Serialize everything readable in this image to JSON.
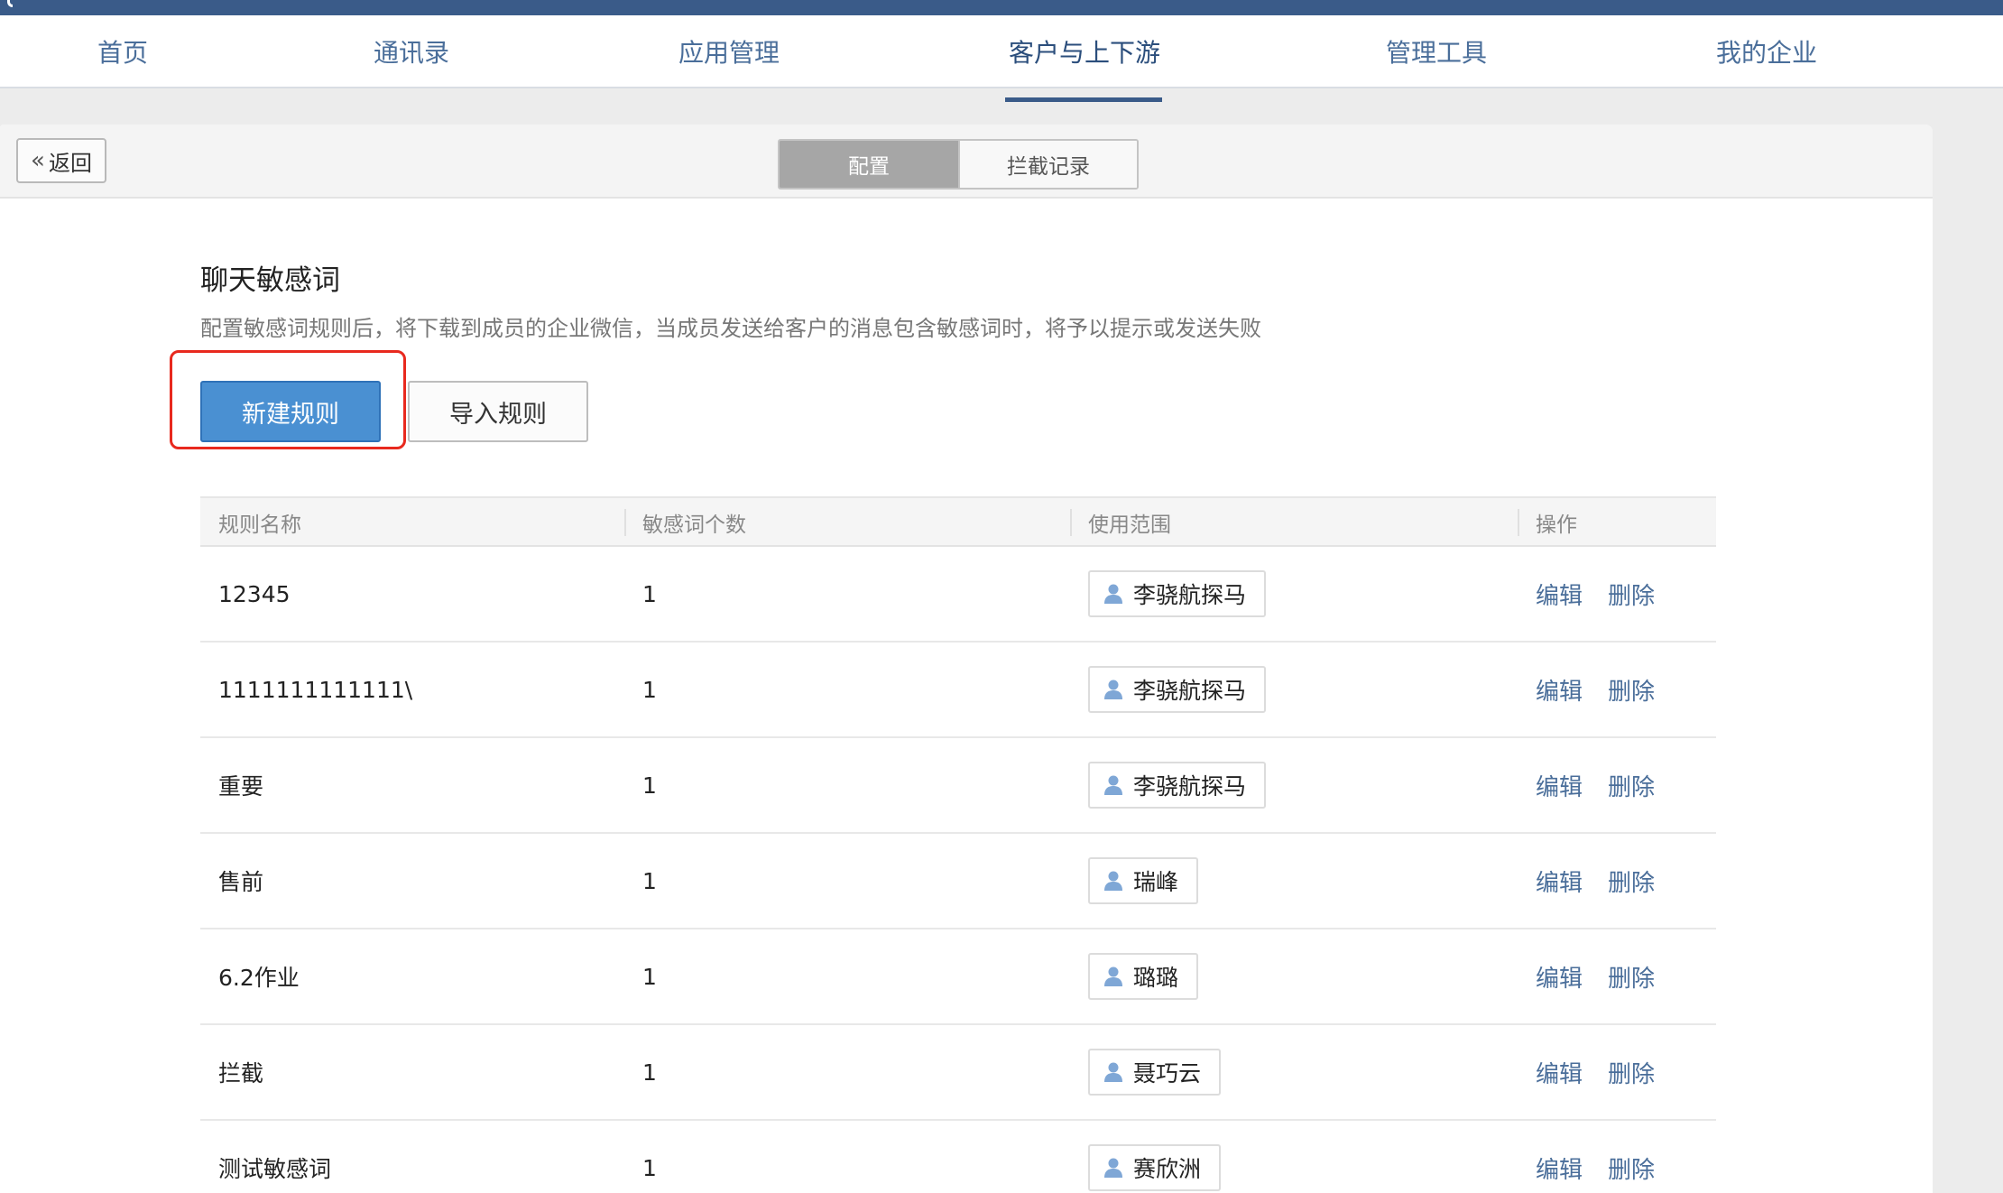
{
  "nav": {
    "items": [
      {
        "label": "首页"
      },
      {
        "label": "通讯录"
      },
      {
        "label": "应用管理"
      },
      {
        "label": "客户与上下游"
      },
      {
        "label": "管理工具"
      },
      {
        "label": "我的企业"
      }
    ],
    "active_index": 3
  },
  "toolbar": {
    "back_label": "返回",
    "back_icon": "double-chevron-left-icon",
    "tabs": [
      {
        "label": "配置",
        "active": true
      },
      {
        "label": "拦截记录",
        "active": false
      }
    ]
  },
  "section": {
    "title": "聊天敏感词",
    "description": "配置敏感词规则后，将下载到成员的企业微信，当成员发送给客户的消息包含敏感词时，将予以提示或发送失败",
    "new_rule_label": "新建规则",
    "import_rule_label": "导入规则"
  },
  "table": {
    "headers": [
      "规则名称",
      "敏感词个数",
      "使用范围",
      "操作"
    ],
    "edit_label": "编辑",
    "delete_label": "删除",
    "rows": [
      {
        "name": "12345",
        "count": "1",
        "scope": "李骁航探马"
      },
      {
        "name": "1111111111111\\",
        "count": "1",
        "scope": "李骁航探马"
      },
      {
        "name": "重要",
        "count": "1",
        "scope": "李骁航探马"
      },
      {
        "name": "售前",
        "count": "1",
        "scope": "瑞峰"
      },
      {
        "name": "6.2作业",
        "count": "1",
        "scope": "璐璐"
      },
      {
        "name": "拦截",
        "count": "1",
        "scope": "聂巧云"
      },
      {
        "name": "测试敏感词",
        "count": "1",
        "scope": "赛欣洲"
      }
    ]
  },
  "colors": {
    "nav_bar": "#3a5b89",
    "link": "#4a6e9a",
    "primary_button": "#4a90d2",
    "highlight_box": "#e8291e"
  }
}
